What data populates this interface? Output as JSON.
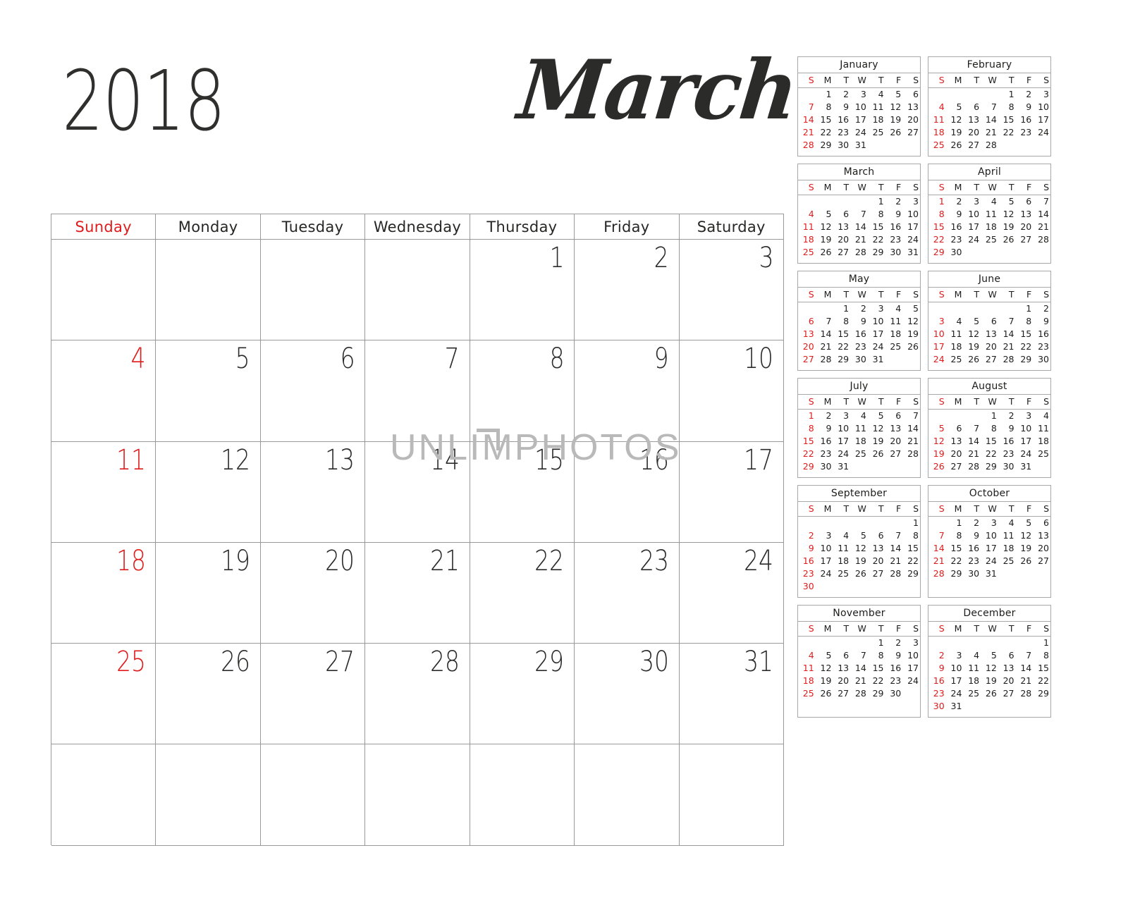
{
  "header": {
    "year": "2018",
    "month": "March"
  },
  "watermark": {
    "text": "UNLIMPHOTOS"
  },
  "colors": {
    "sunday_red": "#e01b1b",
    "text_dark": "#2b2b2a",
    "grid_line": "#9a9a9a",
    "watermark_gray": "#b9b9b9"
  },
  "main_calendar": {
    "weekday_headers": [
      "Sunday",
      "Monday",
      "Tuesday",
      "Wednesday",
      "Thursday",
      "Friday",
      "Saturday"
    ],
    "weeks": [
      [
        "",
        "",
        "",
        "",
        "1",
        "2",
        "3"
      ],
      [
        "4",
        "5",
        "6",
        "7",
        "8",
        "9",
        "10"
      ],
      [
        "11",
        "12",
        "13",
        "14",
        "15",
        "16",
        "17"
      ],
      [
        "18",
        "19",
        "20",
        "21",
        "22",
        "23",
        "24"
      ],
      [
        "25",
        "26",
        "27",
        "28",
        "29",
        "30",
        "31"
      ],
      [
        "",
        "",
        "",
        "",
        "",
        "",
        ""
      ]
    ]
  },
  "mini_calendars": {
    "weekday_headers": [
      "S",
      "M",
      "T",
      "W",
      "T",
      "F",
      "S"
    ],
    "months": [
      {
        "name": "January",
        "weeks": [
          [
            "",
            "1",
            "2",
            "3",
            "4",
            "5",
            "6"
          ],
          [
            "7",
            "8",
            "9",
            "10",
            "11",
            "12",
            "13"
          ],
          [
            "14",
            "15",
            "16",
            "17",
            "18",
            "19",
            "20"
          ],
          [
            "21",
            "22",
            "23",
            "24",
            "25",
            "26",
            "27"
          ],
          [
            "28",
            "29",
            "30",
            "31",
            "",
            "",
            ""
          ]
        ]
      },
      {
        "name": "February",
        "weeks": [
          [
            "",
            "",
            "",
            "",
            "1",
            "2",
            "3"
          ],
          [
            "4",
            "5",
            "6",
            "7",
            "8",
            "9",
            "10"
          ],
          [
            "11",
            "12",
            "13",
            "14",
            "15",
            "16",
            "17"
          ],
          [
            "18",
            "19",
            "20",
            "21",
            "22",
            "23",
            "24"
          ],
          [
            "25",
            "26",
            "27",
            "28",
            "",
            "",
            ""
          ]
        ]
      },
      {
        "name": "March",
        "weeks": [
          [
            "",
            "",
            "",
            "",
            "1",
            "2",
            "3"
          ],
          [
            "4",
            "5",
            "6",
            "7",
            "8",
            "9",
            "10"
          ],
          [
            "11",
            "12",
            "13",
            "14",
            "15",
            "16",
            "17"
          ],
          [
            "18",
            "19",
            "20",
            "21",
            "22",
            "23",
            "24"
          ],
          [
            "25",
            "26",
            "27",
            "28",
            "29",
            "30",
            "31"
          ]
        ]
      },
      {
        "name": "April",
        "weeks": [
          [
            "1",
            "2",
            "3",
            "4",
            "5",
            "6",
            "7"
          ],
          [
            "8",
            "9",
            "10",
            "11",
            "12",
            "13",
            "14"
          ],
          [
            "15",
            "16",
            "17",
            "18",
            "19",
            "20",
            "21"
          ],
          [
            "22",
            "23",
            "24",
            "25",
            "26",
            "27",
            "28"
          ],
          [
            "29",
            "30",
            "",
            "",
            "",
            "",
            ""
          ]
        ]
      },
      {
        "name": "May",
        "weeks": [
          [
            "",
            "",
            "1",
            "2",
            "3",
            "4",
            "5"
          ],
          [
            "6",
            "7",
            "8",
            "9",
            "10",
            "11",
            "12"
          ],
          [
            "13",
            "14",
            "15",
            "16",
            "17",
            "18",
            "19"
          ],
          [
            "20",
            "21",
            "22",
            "23",
            "24",
            "25",
            "26"
          ],
          [
            "27",
            "28",
            "29",
            "30",
            "31",
            "",
            ""
          ]
        ]
      },
      {
        "name": "June",
        "weeks": [
          [
            "",
            "",
            "",
            "",
            "",
            "1",
            "2"
          ],
          [
            "3",
            "4",
            "5",
            "6",
            "7",
            "8",
            "9"
          ],
          [
            "10",
            "11",
            "12",
            "13",
            "14",
            "15",
            "16"
          ],
          [
            "17",
            "18",
            "19",
            "20",
            "21",
            "22",
            "23"
          ],
          [
            "24",
            "25",
            "26",
            "27",
            "28",
            "29",
            "30"
          ]
        ]
      },
      {
        "name": "July",
        "weeks": [
          [
            "1",
            "2",
            "3",
            "4",
            "5",
            "6",
            "7"
          ],
          [
            "8",
            "9",
            "10",
            "11",
            "12",
            "13",
            "14"
          ],
          [
            "15",
            "16",
            "17",
            "18",
            "19",
            "20",
            "21"
          ],
          [
            "22",
            "23",
            "24",
            "25",
            "26",
            "27",
            "28"
          ],
          [
            "29",
            "30",
            "31",
            "",
            "",
            "",
            ""
          ]
        ]
      },
      {
        "name": "August",
        "weeks": [
          [
            "",
            "",
            "",
            "1",
            "2",
            "3",
            "4"
          ],
          [
            "5",
            "6",
            "7",
            "8",
            "9",
            "10",
            "11"
          ],
          [
            "12",
            "13",
            "14",
            "15",
            "16",
            "17",
            "18"
          ],
          [
            "19",
            "20",
            "21",
            "22",
            "23",
            "24",
            "25"
          ],
          [
            "26",
            "27",
            "28",
            "29",
            "30",
            "31",
            ""
          ]
        ]
      },
      {
        "name": "September",
        "weeks": [
          [
            "",
            "",
            "",
            "",
            "",
            "",
            "1"
          ],
          [
            "2",
            "3",
            "4",
            "5",
            "6",
            "7",
            "8"
          ],
          [
            "9",
            "10",
            "11",
            "12",
            "13",
            "14",
            "15"
          ],
          [
            "16",
            "17",
            "18",
            "19",
            "20",
            "21",
            "22"
          ],
          [
            "23",
            "24",
            "25",
            "26",
            "27",
            "28",
            "29"
          ],
          [
            "30",
            "",
            "",
            "",
            "",
            "",
            ""
          ]
        ]
      },
      {
        "name": "October",
        "weeks": [
          [
            "",
            "1",
            "2",
            "3",
            "4",
            "5",
            "6"
          ],
          [
            "7",
            "8",
            "9",
            "10",
            "11",
            "12",
            "13"
          ],
          [
            "14",
            "15",
            "16",
            "17",
            "18",
            "19",
            "20"
          ],
          [
            "21",
            "22",
            "23",
            "24",
            "25",
            "26",
            "27"
          ],
          [
            "28",
            "29",
            "30",
            "31",
            "",
            "",
            ""
          ]
        ]
      },
      {
        "name": "November",
        "weeks": [
          [
            "",
            "",
            "",
            "",
            "1",
            "2",
            "3"
          ],
          [
            "4",
            "5",
            "6",
            "7",
            "8",
            "9",
            "10"
          ],
          [
            "11",
            "12",
            "13",
            "14",
            "15",
            "16",
            "17"
          ],
          [
            "18",
            "19",
            "20",
            "21",
            "22",
            "23",
            "24"
          ],
          [
            "25",
            "26",
            "27",
            "28",
            "29",
            "30",
            ""
          ]
        ]
      },
      {
        "name": "December",
        "weeks": [
          [
            "",
            "",
            "",
            "",
            "",
            "",
            "1"
          ],
          [
            "2",
            "3",
            "4",
            "5",
            "6",
            "7",
            "8"
          ],
          [
            "9",
            "10",
            "11",
            "12",
            "13",
            "14",
            "15"
          ],
          [
            "16",
            "17",
            "18",
            "19",
            "20",
            "21",
            "22"
          ],
          [
            "23",
            "24",
            "25",
            "26",
            "27",
            "28",
            "29"
          ],
          [
            "30",
            "31",
            "",
            "",
            "",
            "",
            ""
          ]
        ]
      }
    ]
  }
}
